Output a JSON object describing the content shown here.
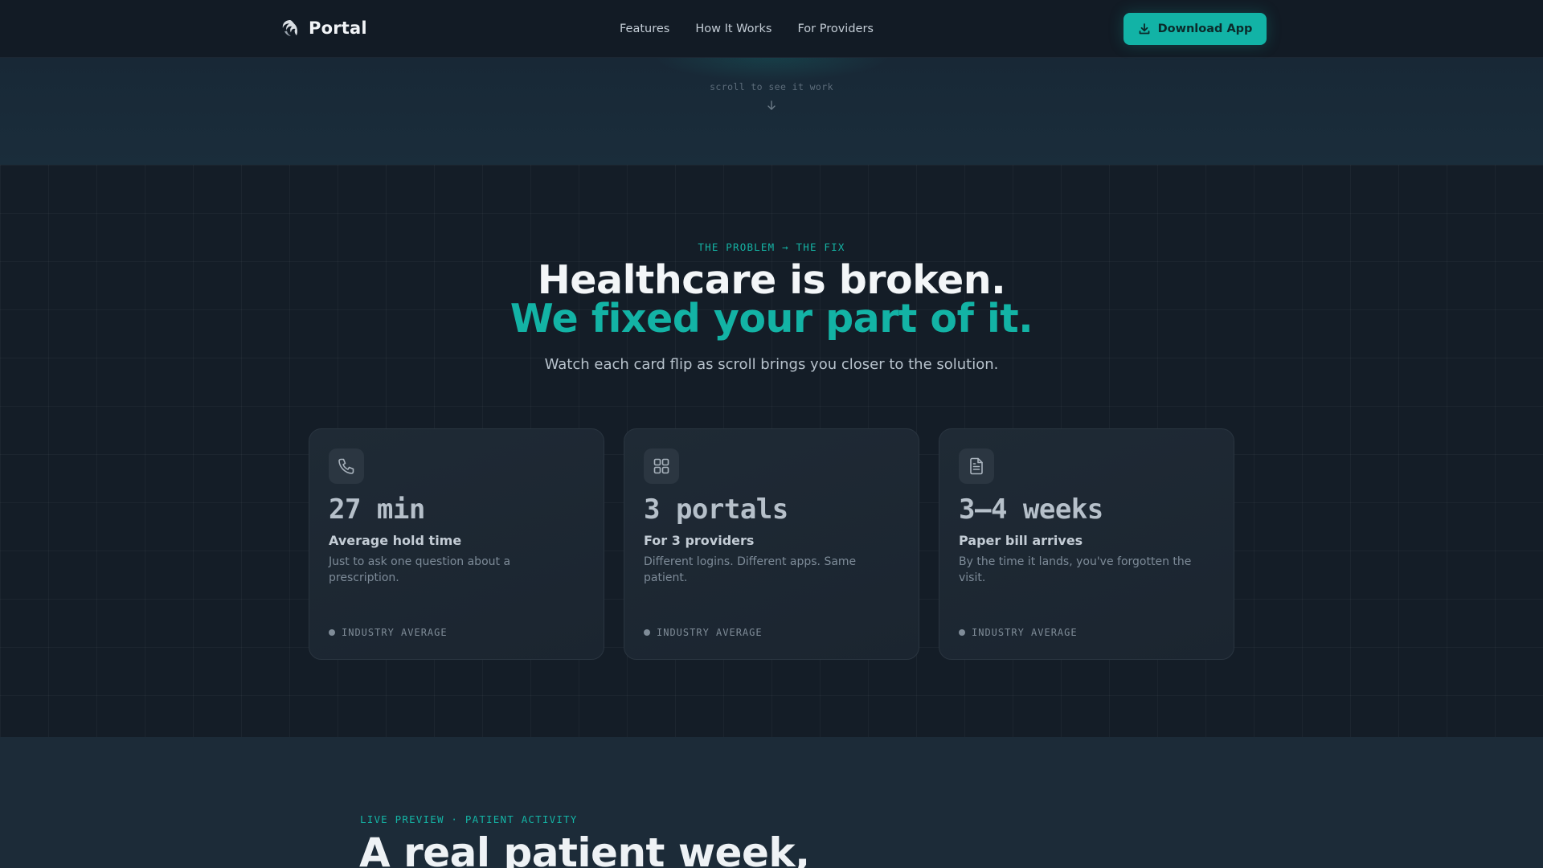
{
  "nav": {
    "brand_name": "Portal",
    "logo_icon": "portal-swirl-icon",
    "links": [
      {
        "label": "Features"
      },
      {
        "label": "How It Works"
      },
      {
        "label": "For Providers"
      }
    ],
    "cta_label": "Download App",
    "cta_icon": "download-icon"
  },
  "scroll_hint": {
    "text": "scroll to see it work",
    "icon": "arrow-down-icon"
  },
  "problem": {
    "eyebrow": "THE PROBLEM → THE FIX",
    "headline_line1": "Healthcare is broken.",
    "headline_line2": "We fixed your part of it.",
    "subhead": "Watch each card flip as scroll brings you closer to the solution.",
    "cards": [
      {
        "icon": "phone-icon",
        "stat": "27 min",
        "title": "Average hold time",
        "description": "Just to ask one question about a prescription.",
        "tag": "INDUSTRY AVERAGE"
      },
      {
        "icon": "grid-icon",
        "stat": "3 portals",
        "title": "For 3 providers",
        "description": "Different logins. Different apps. Same patient.",
        "tag": "INDUSTRY AVERAGE"
      },
      {
        "icon": "document-icon",
        "stat": "3–4 weeks",
        "title": "Paper bill arrives",
        "description": "By the time it lands, you've forgotten the visit.",
        "tag": "INDUSTRY AVERAGE"
      }
    ]
  },
  "preview": {
    "eyebrow": "LIVE PREVIEW · PATIENT ACTIVITY",
    "title": "A real patient week,"
  },
  "colors": {
    "accent": "#12b3a6",
    "background": "#141d27",
    "nav_background": "#121b25",
    "card_background": "#1f2a35",
    "preview_background": "#1c2b38"
  }
}
